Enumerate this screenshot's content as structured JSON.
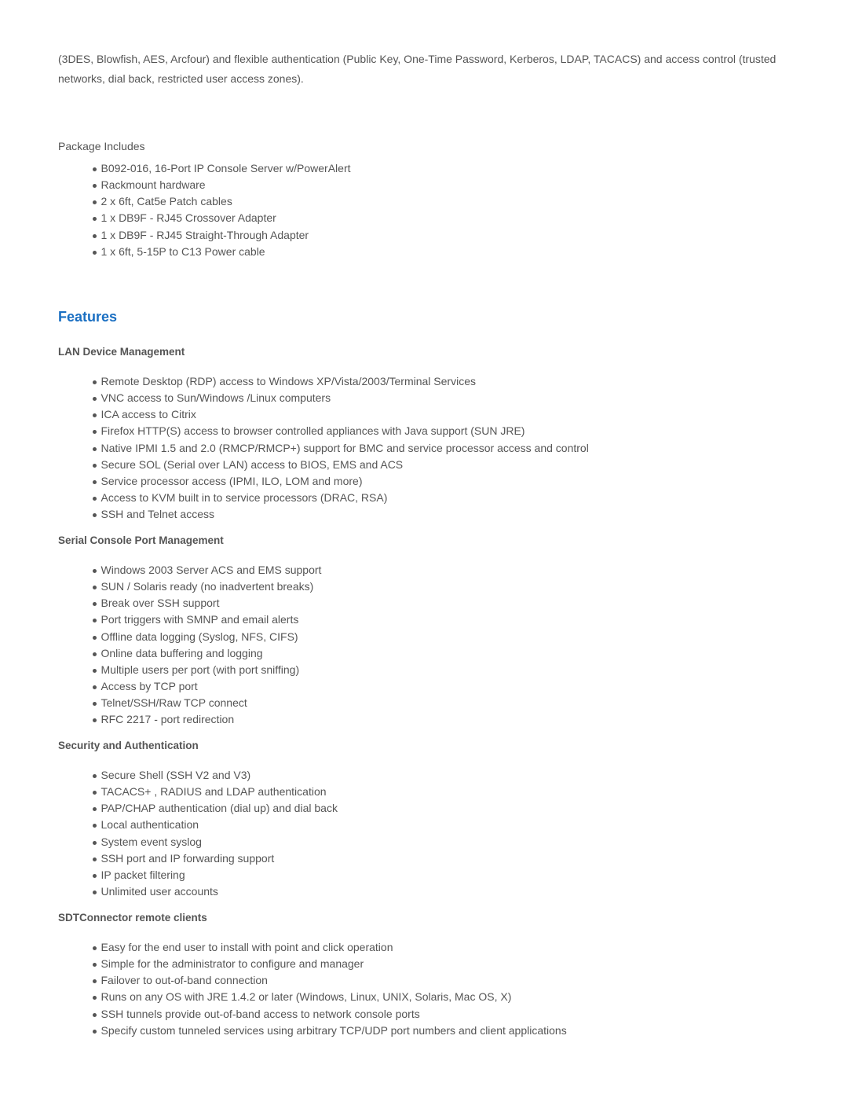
{
  "intro": {
    "text": "(3DES, Blowfish, AES, Arcfour) and flexible authentication (Public Key, One-Time Password, Kerberos, LDAP, TACACS) and access control (trusted networks, dial back, restricted user access zones)."
  },
  "package": {
    "title": "Package Includes",
    "items": [
      "B092-016, 16-Port IP Console Server w/PowerAlert",
      "Rackmount hardware",
      "2 x 6ft, Cat5e Patch cables",
      "1 x DB9F - RJ45 Crossover Adapter",
      "1 x DB9F - RJ45 Straight-Through Adapter",
      "1 x 6ft, 5-15P to C13 Power cable"
    ]
  },
  "features": {
    "title": "Features",
    "title_color": "#1a6fc2",
    "sections": [
      {
        "heading": "LAN Device Management",
        "items": [
          "Remote Desktop (RDP) access to Windows XP/Vista/2003/Terminal Services",
          "VNC access to Sun/Windows /Linux computers",
          "ICA access to Citrix",
          "Firefox HTTP(S) access to browser controlled appliances with Java support (SUN JRE)",
          "Native IPMI 1.5 and 2.0 (RMCP/RMCP+) support for BMC and service processor access and control",
          "Secure SOL (Serial over LAN) access to BIOS, EMS and ACS",
          "Service processor access (IPMI, ILO, LOM and more)",
          "Access to KVM built in to service processors (DRAC, RSA)",
          "SSH and Telnet access"
        ]
      },
      {
        "heading": "Serial Console Port Management",
        "items": [
          "Windows 2003 Server ACS and EMS support",
          "SUN / Solaris ready (no inadvertent breaks)",
          "Break over SSH support",
          "Port triggers with SMNP and email alerts",
          "Offline data logging (Syslog, NFS, CIFS)",
          "Online data buffering and logging",
          "Multiple users per port (with port sniffing)",
          "Access by TCP port",
          "Telnet/SSH/Raw TCP connect",
          "RFC 2217 - port redirection"
        ]
      },
      {
        "heading": "Security and Authentication",
        "items": [
          "Secure Shell (SSH V2 and V3)",
          "TACACS+ , RADIUS and LDAP authentication",
          "PAP/CHAP authentication (dial up) and dial back",
          "Local authentication",
          "System event syslog",
          "SSH port and IP forwarding support",
          "IP packet filtering",
          "Unlimited user accounts"
        ]
      },
      {
        "heading": "SDTConnector remote clients",
        "items": [
          "Easy for the end user to install with point and click operation",
          "Simple for the administrator to configure and manager",
          "Failover to out-of-band connection",
          "Runs on any OS with JRE 1.4.2 or later (Windows, Linux, UNIX, Solaris, Mac OS, X)",
          "SSH tunnels provide out-of-band access to network console ports",
          "Specify custom tunneled services using arbitrary TCP/UDP port numbers and client applications"
        ]
      }
    ]
  }
}
